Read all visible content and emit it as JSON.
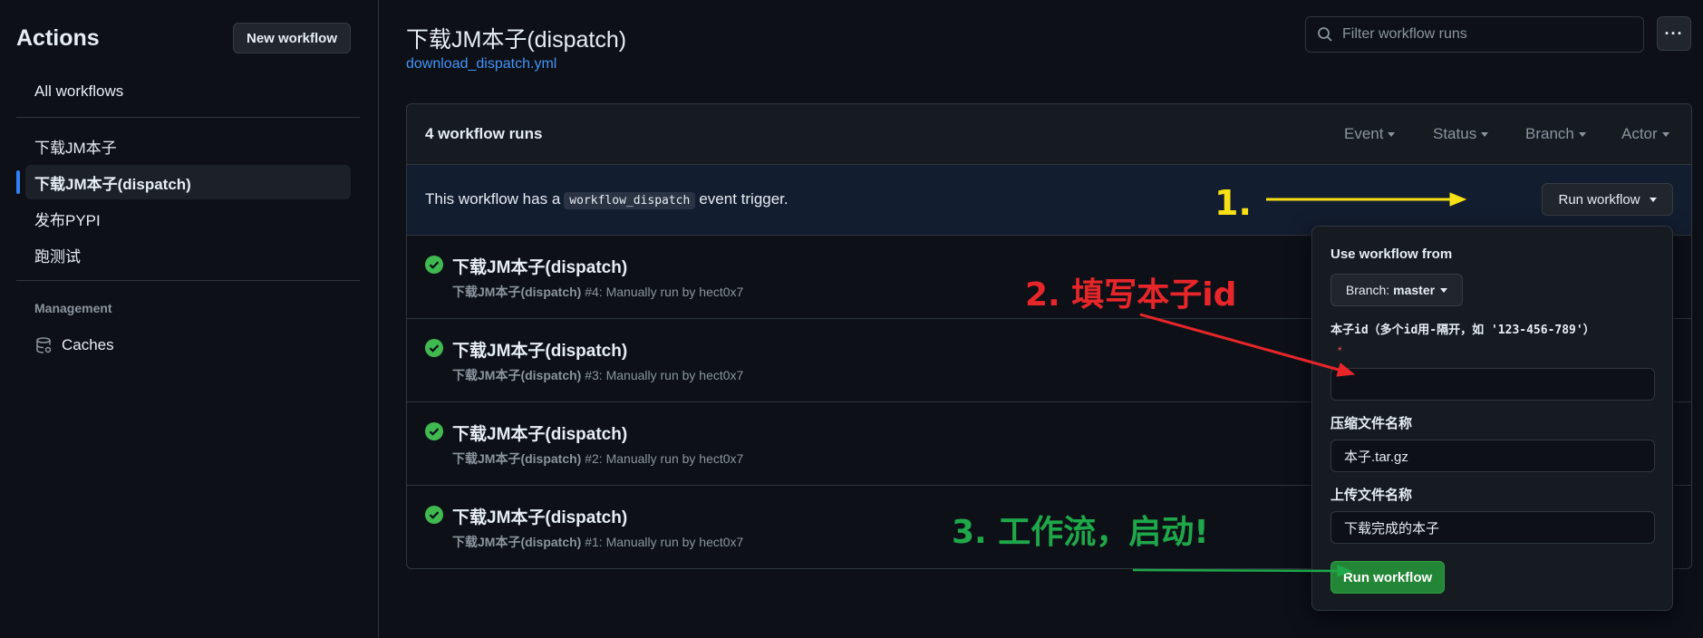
{
  "sidebar": {
    "title": "Actions",
    "new_workflow_label": "New workflow",
    "all_workflows": "All workflows",
    "items": [
      {
        "label": "下载JM本子"
      },
      {
        "label": "下载JM本子(dispatch)"
      },
      {
        "label": "发布PYPI"
      },
      {
        "label": "跑测试"
      }
    ],
    "management_label": "Management",
    "caches_label": "Caches",
    "caches_icon": "database-icon"
  },
  "header": {
    "title": "下载JM本子(dispatch)",
    "file_link": "download_dispatch.yml",
    "filter_placeholder": "Filter workflow runs",
    "more_label": "···"
  },
  "runs": {
    "count_label": "4 workflow runs",
    "filters": [
      "Event",
      "Status",
      "Branch",
      "Actor"
    ],
    "dispatch_prefix": "This workflow has a",
    "dispatch_code": "workflow_dispatch",
    "dispatch_suffix": "event trigger.",
    "run_workflow_label": "Run workflow",
    "items": [
      {
        "title": "下载JM本子(dispatch)",
        "workflow": "下载JM本子(dispatch)",
        "detail": "#4: Manually run by hect0x7",
        "status": "success"
      },
      {
        "title": "下载JM本子(dispatch)",
        "workflow": "下载JM本子(dispatch)",
        "detail": "#3: Manually run by hect0x7",
        "status": "success"
      },
      {
        "title": "下载JM本子(dispatch)",
        "workflow": "下载JM本子(dispatch)",
        "detail": "#2: Manually run by hect0x7",
        "status": "success"
      },
      {
        "title": "下载JM本子(dispatch)",
        "workflow": "下载JM本子(dispatch)",
        "detail": "#1: Manually run by hect0x7",
        "status": "success"
      }
    ]
  },
  "panel": {
    "use_from_label": "Use workflow from",
    "branch_prefix": "Branch:",
    "branch_value": "master",
    "field1_label": "本子id（多个id用-隔开，如 '123-456-789'）",
    "field1_required": "*",
    "field1_value": "",
    "field2_label": "压缩文件名称",
    "field2_value": "本子.tar.gz",
    "field3_label": "上传文件名称",
    "field3_value": "下载完成的本子",
    "submit_label": "Run workflow"
  },
  "annotations": {
    "step1": "1.",
    "step2": "2. 填写本子id",
    "step3": "3. 工作流，启动!",
    "colors": {
      "step1": "#f7e014",
      "step2": "#e8262a",
      "step3": "#1fa84a"
    }
  },
  "colors": {
    "accent": "#2f81f7",
    "link": "#4493f8",
    "success": "#3fb950",
    "primary_button": "#238636"
  }
}
